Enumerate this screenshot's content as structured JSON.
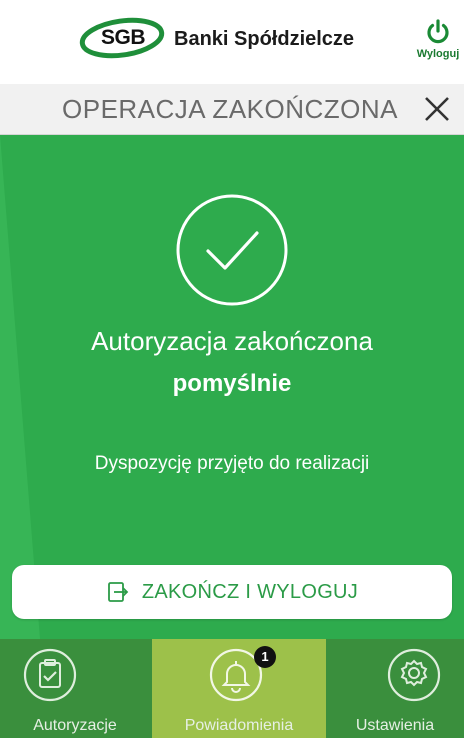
{
  "header": {
    "logo_text": "SGB",
    "brand": "Banki Spółdzielcze",
    "logout_label": "Wyloguj"
  },
  "titlebar": {
    "title": "OPERACJA ZAKOŃCZONA"
  },
  "main": {
    "auth_line1": "Autoryzacja zakończona",
    "auth_line2": "pomyślnie",
    "auth_sub": "Dyspozycję przyjęto do realizacji",
    "finish_button": "ZAKOŃCZ I WYLOGUJ"
  },
  "nav": {
    "items": [
      {
        "label": "Autoryzacje",
        "icon": "clipboard-check-icon"
      },
      {
        "label": "Powiadomienia",
        "icon": "bell-icon",
        "badge": "1",
        "active": true
      },
      {
        "label": "Ustawienia",
        "icon": "gear-icon"
      }
    ]
  },
  "colors": {
    "primary_green": "#2eab4d",
    "nav_green": "#3a8f3d",
    "active_tab": "#9dc14a"
  }
}
